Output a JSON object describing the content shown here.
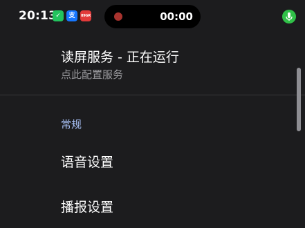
{
  "status_bar": {
    "time": "20:13",
    "app_icons": [
      {
        "name": "wechat-icon",
        "glyph": "✓",
        "color": "#22c35e"
      },
      {
        "name": "alipay-icon",
        "glyph": "支",
        "color": "#1677ff"
      },
      {
        "name": "red-app-icon",
        "glyph": "89GR",
        "color": "#e23a3a"
      }
    ],
    "recording": {
      "timer": "00:00",
      "dot_color": "#e0443e"
    },
    "mic_indicator_color": "#30c148"
  },
  "settings": {
    "service": {
      "title": "读屏服务 - 正在运行",
      "subtitle": "点此配置服务"
    },
    "section_header": "常规",
    "items": [
      {
        "label": "语音设置"
      },
      {
        "label": "播报设置"
      }
    ]
  },
  "colors": {
    "background": "#1c1c1e",
    "section_accent": "#a9c2f7",
    "subtitle": "#9a9a9e"
  }
}
